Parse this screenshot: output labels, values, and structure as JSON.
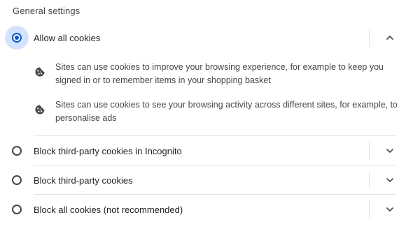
{
  "section_title": "General settings",
  "options": [
    {
      "label": "Allow all cookies",
      "selected": true,
      "expanded": true,
      "details": [
        {
          "icon": "cookie-icon",
          "text": "Sites can use cookies to improve your browsing experience, for example to keep you signed in or to remember items in your shopping basket"
        },
        {
          "icon": "cookie-icon",
          "text": "Sites can use cookies to see your browsing activity across different sites, for example, to personalise ads"
        }
      ]
    },
    {
      "label": "Block third-party cookies in Incognito",
      "selected": false,
      "expanded": false
    },
    {
      "label": "Block third-party cookies",
      "selected": false,
      "expanded": false
    },
    {
      "label": "Block all cookies (not recommended)",
      "selected": false,
      "expanded": false
    }
  ],
  "colors": {
    "accent": "#0b57d0",
    "halo": "#d3e3fd",
    "text": "#1f1f1f",
    "secondary_text": "#474747",
    "divider": "#e3e3e3"
  }
}
